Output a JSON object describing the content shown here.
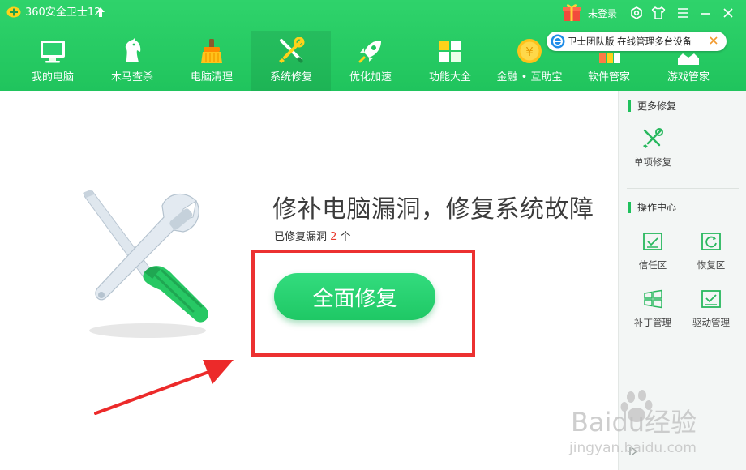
{
  "app": {
    "title": "360安全卫士12",
    "login_label": "未登录"
  },
  "nav": {
    "tabs": [
      {
        "label": "我的电脑",
        "icon": "monitor-icon"
      },
      {
        "label": "木马查杀",
        "icon": "horse-icon"
      },
      {
        "label": "电脑清理",
        "icon": "broom-icon"
      },
      {
        "label": "系统修复",
        "icon": "tools-icon",
        "active": true
      },
      {
        "label": "优化加速",
        "icon": "rocket-icon"
      },
      {
        "label": "功能大全",
        "icon": "apps-grid-icon"
      },
      {
        "label": "金融 • 互助宝",
        "icon": "coin-icon"
      },
      {
        "label": "软件管家",
        "icon": "software-icon"
      },
      {
        "label": "游戏管家",
        "icon": "game-icon"
      }
    ]
  },
  "promo": {
    "text": "卫士团队版 在线管理多台设备"
  },
  "main": {
    "headline": "修补电脑漏洞，修复系统故障",
    "fixed_prefix": "已修复漏洞 ",
    "fixed_count": "2",
    "fixed_suffix": " 个",
    "fix_button": "全面修复"
  },
  "sidebar": {
    "more_title": "更多修复",
    "single_fix": "单项修复",
    "ops_title": "操作中心",
    "items": [
      {
        "label": "信任区",
        "icon": "trust-zone-icon"
      },
      {
        "label": "恢复区",
        "icon": "restore-zone-icon"
      },
      {
        "label": "补丁管理",
        "icon": "windows-patch-icon"
      },
      {
        "label": "驱动管理",
        "icon": "driver-icon"
      }
    ]
  },
  "watermark": {
    "brand": "Baidu经验",
    "url": "jingyan.baidu.com"
  },
  "colors": {
    "brand_green": "#20c45d",
    "button_green": "#25cc6a",
    "alert_red": "#ec3131",
    "count_red": "#e8382c"
  }
}
